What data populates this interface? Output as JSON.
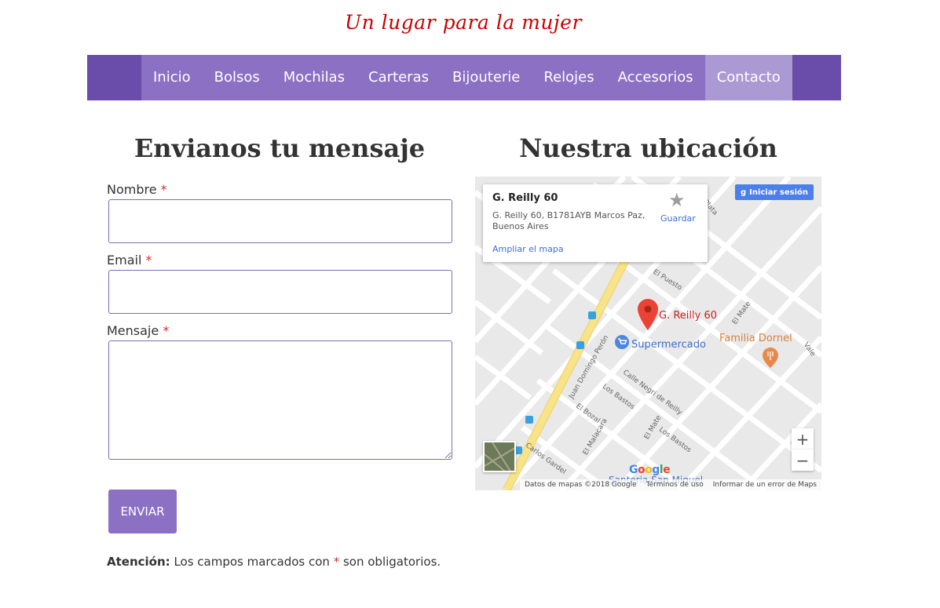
{
  "site": {
    "tagline": "Un lugar para la mujer"
  },
  "nav": {
    "items": [
      {
        "label": "Inicio"
      },
      {
        "label": "Bolsos"
      },
      {
        "label": "Mochilas"
      },
      {
        "label": "Carteras"
      },
      {
        "label": "Bijouterie"
      },
      {
        "label": "Relojes"
      },
      {
        "label": "Accesorios"
      },
      {
        "label": "Contacto",
        "active": true
      }
    ]
  },
  "form": {
    "heading": "Envianos tu mensaje",
    "fields": {
      "name": {
        "label": "Nombre",
        "required_mark": "*",
        "value": ""
      },
      "email": {
        "label": "Email",
        "required_mark": "*",
        "value": ""
      },
      "message": {
        "label": "Mensaje",
        "required_mark": "*",
        "value": ""
      }
    },
    "submit_label": "ENVIAR",
    "notice": {
      "strong": "Atención:",
      "pre": "Los campos marcados con",
      "mark": "*",
      "post": "son obligatorios."
    }
  },
  "map": {
    "heading": "Nuestra ubicación",
    "card": {
      "title": "G. Reilly 60",
      "address": "G. Reilly 60, B1781AYB Marcos Paz, Buenos Aires",
      "expand_link": "Ampliar el mapa",
      "save_label": "Guardar"
    },
    "signin_label": "Iniciar sesión",
    "zoom_in": "+",
    "zoom_out": "−",
    "pin_label": "G. Reilly 60",
    "places": {
      "supermarket": "Supermercado",
      "restaurant": "Familia Dornel",
      "bottom_place": "Santeria San Miguel"
    },
    "streets": [
      "El Puesto",
      "El Mate",
      "Juan Domingo Perón",
      "Calle Negri de Reilly",
      "Los Bastos",
      "El Bozal",
      "El Malacara",
      "Carlos Gardel",
      "El Mate",
      "Los Bastos",
      "Plata",
      "Vale"
    ],
    "attribution": {
      "data": "Datos de mapas ©2018 Google",
      "terms": "Términos de uso",
      "report": "Informar de un error de Maps"
    },
    "google_logo": "Google",
    "colors": {
      "pin": "#ea4335",
      "road_major": "#f7e48a",
      "restaurant": "#e8894a",
      "supermarket": "#4c86e0"
    }
  }
}
